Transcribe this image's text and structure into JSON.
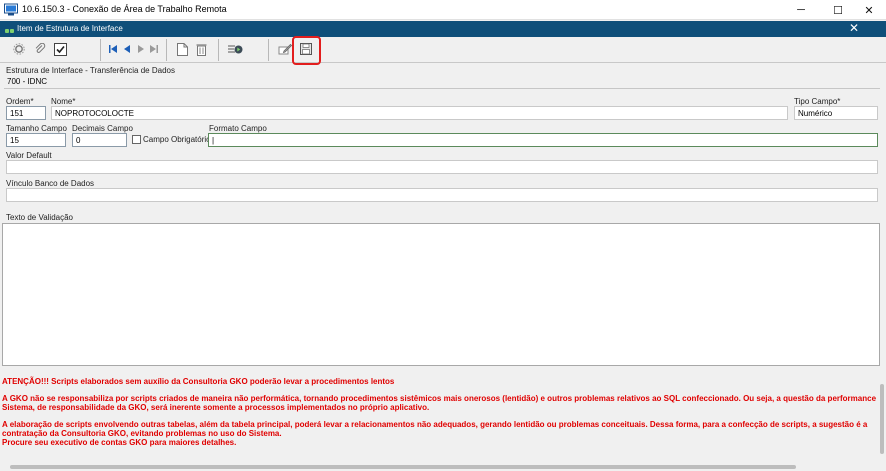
{
  "window": {
    "title": "10.6.150.3 - Conexão de Área de Trabalho Remota",
    "minimize": "─",
    "maximize": "☐",
    "close": "✕"
  },
  "inner_window": {
    "title": "Item de Estrutura de Interface",
    "close": "✕"
  },
  "form": {
    "estrutura_label": "Estrutura de Interface - Transferência de Dados",
    "estrutura_value": "700 - IDNC",
    "ordem_label": "Ordem*",
    "ordem_value": "151",
    "nome_label": "Nome*",
    "nome_value": "NOPROTOCOLOCTE",
    "tipo_campo_label": "Tipo Campo*",
    "tipo_campo_value": "Numérico",
    "tamanho_label": "Tamanho Campo",
    "tamanho_value": "15",
    "decimais_label": "Decimais Campo",
    "decimais_value": "0",
    "obrigatorio_label": "Campo Obrigatório",
    "formato_label": "Formato Campo",
    "formato_value": "|",
    "valor_default_label": "Valor Default",
    "valor_default_value": "",
    "vinculo_label": "Vínculo Banco de Dados",
    "vinculo_value": "",
    "texto_validacao_label": "Texto de Validação"
  },
  "warnings": {
    "line1": "ATENÇÃO!!! Scripts elaborados sem auxílio da Consultoria GKO poderão levar a procedimentos lentos",
    "para1a": "A GKO não se responsabiliza por scripts criados de maneira não performática, tornando procedimentos sistêmicos mais onerosos (lentidão) e outros problemas relativos ao SQL confeccionado. Ou seja, a questão da performance",
    "para1b": "Sistema, de responsabilidade da GKO, será inerente somente a processos implementados no próprio aplicativo.",
    "para2a": "A elaboração de scripts envolvendo outras tabelas, além da tabela principal, poderá levar a relacionamentos não adequados, gerando lentidão ou problemas conceituais. Dessa forma, para a confecção de scripts, a sugestão é a",
    "para2b": "contratação da Consultoria GKO, evitando problemas no uso do Sistema.",
    "para2c": "Procure seu executivo de contas GKO para maiores detalhes."
  },
  "toolbar_icons": [
    "gear-icon",
    "paperclip-icon",
    "checkbox-icon",
    "first-record-icon",
    "previous-record-icon",
    "next-record-icon",
    "last-record-icon",
    "new-document-icon",
    "delete-icon",
    "run-query-icon",
    "edit-icon",
    "save-icon"
  ],
  "colors": {
    "inner_title_bar": "#0f4f7a",
    "warning_text": "#e00000",
    "highlight_box": "#e21d1d",
    "nav_arrows": "#1d5fb8"
  }
}
